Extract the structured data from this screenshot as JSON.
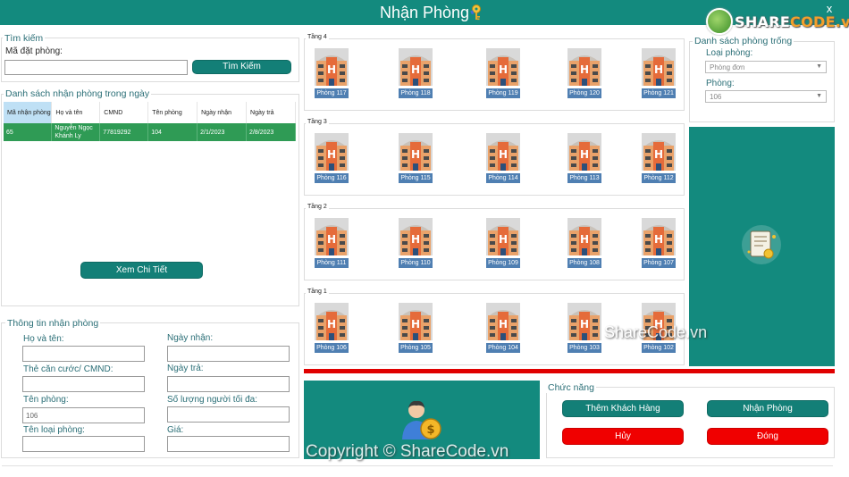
{
  "window": {
    "title": "Nhận Phòng",
    "close": "x",
    "logo_prefix": "SHARE",
    "logo_suffix": "CODE.vn",
    "watermark_mid": "ShareCode.vn",
    "watermark_bottom": "Copyright © ShareCode.vn"
  },
  "search": {
    "group_title": "Tìm kiếm",
    "label": "Mã đặt phòng:",
    "value": "",
    "button": "Tìm Kiếm"
  },
  "today_list": {
    "group_title": "Danh sách nhận phòng trong ngày",
    "columns": [
      "Mã nhận phòng",
      "Họ và tên",
      "CMND",
      "Tên phòng",
      "Ngày nhận",
      "Ngày trả"
    ],
    "rows": [
      [
        "65",
        "Nguyễn Ngọc Khánh Ly",
        "77819292",
        "104",
        "2/1/2023",
        "2/8/2023"
      ]
    ],
    "detail_button": "Xem Chi Tiết"
  },
  "checkin_info": {
    "group_title": "Thông tin nhận phòng",
    "full_name_label": "Họ và tên:",
    "id_card_label": "Thẻ căn cước/ CMND:",
    "room_name_label": "Tên phòng:",
    "room_name_value": "106",
    "room_type_label": "Tên loại phòng:",
    "checkin_date_label": "Ngày nhận:",
    "checkout_date_label": "Ngày trả:",
    "max_guests_label": "Số lượng người tối đa:",
    "price_label": "Giá:"
  },
  "floors": [
    {
      "title": "Tầng 4",
      "rooms": [
        "Phòng 117",
        "Phòng 118",
        "Phòng 119",
        "Phòng 120",
        "Phòng 121"
      ]
    },
    {
      "title": "Tầng 3",
      "rooms": [
        "Phòng 116",
        "Phòng 115",
        "Phòng 114",
        "Phòng 113",
        "Phòng 112"
      ]
    },
    {
      "title": "Tầng 2",
      "rooms": [
        "Phòng 111",
        "Phòng 110",
        "Phòng 109",
        "Phòng 108",
        "Phòng 107"
      ]
    },
    {
      "title": "Tầng 1",
      "rooms": [
        "Phòng 106",
        "Phòng 105",
        "Phòng 104",
        "Phòng 103",
        "Phòng 102"
      ]
    }
  ],
  "empty_rooms": {
    "group_title": "Danh sách phòng trống",
    "room_type_label": "Loại phòng:",
    "room_type_value": "Phòng đơn",
    "room_label": "Phòng:",
    "room_value": "106"
  },
  "functions": {
    "group_title": "Chức năng",
    "add_customer": "Thêm Khách Hàng",
    "check_in": "Nhận Phòng",
    "cancel": "Hủy",
    "close": "Đóng"
  },
  "colors": {
    "teal": "#138a7e",
    "row_green": "#2f9b55",
    "danger": "#f00000",
    "room_caption": "#4f7fb2"
  }
}
